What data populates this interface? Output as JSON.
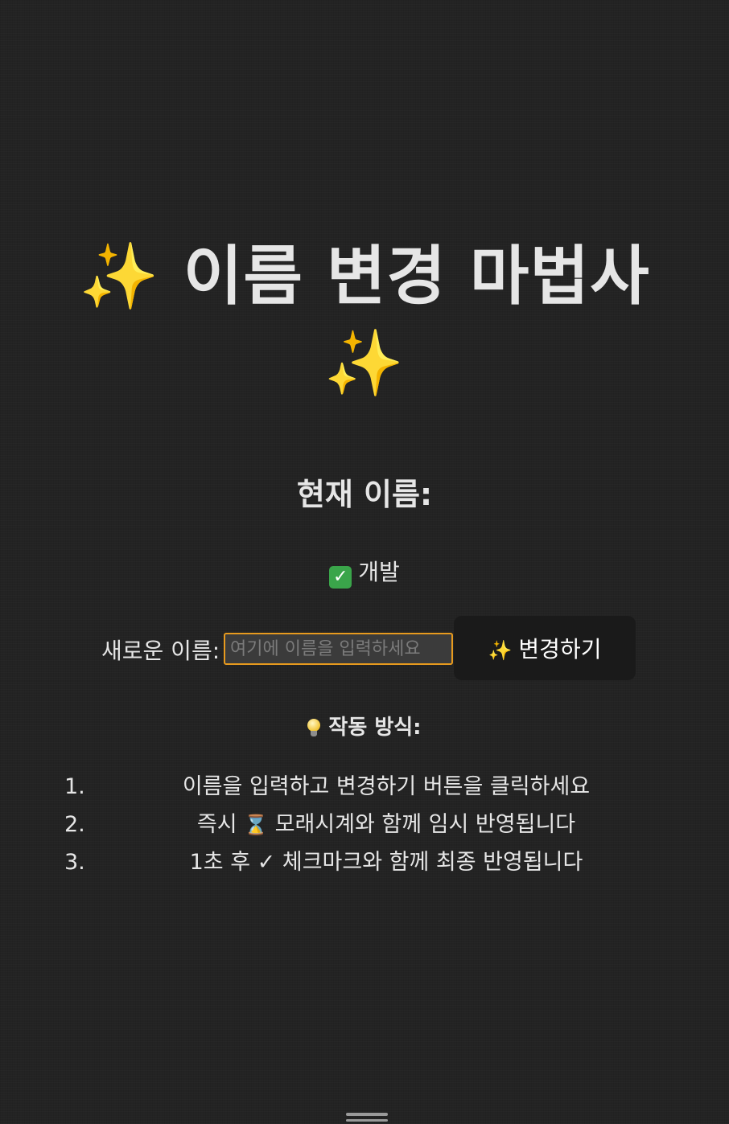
{
  "header": {
    "sparkle_left": "✨",
    "title": "이름 변경 마법사",
    "sparkle_right": "✨"
  },
  "current": {
    "label": "현재 이름:",
    "status_icon": "check-icon",
    "value": "개발"
  },
  "form": {
    "label": "새로운 이름:",
    "input_value": "",
    "input_placeholder": "여기에 이름을 입력하세요",
    "button_icon": "✨",
    "button_label": "변경하기"
  },
  "how": {
    "icon": "bulb-icon",
    "title": "작동 방식:",
    "steps": [
      {
        "num": "1.",
        "text": "이름을 입력하고 변경하기 버튼을 클릭하세요"
      },
      {
        "num": "2.",
        "text_before": "즉시 ",
        "icon": "⌛",
        "text_after": " 모래시계와 함께 임시 반영됩니다"
      },
      {
        "num": "3.",
        "text": "1초 후 ✓ 체크마크와 함께 최종 반영됩니다"
      }
    ]
  },
  "colors": {
    "background": "#232323",
    "text": "#e6e6e6",
    "accent_border": "#e79a1e",
    "sparkle": "#f5c542",
    "check_green": "#3aa54a"
  }
}
